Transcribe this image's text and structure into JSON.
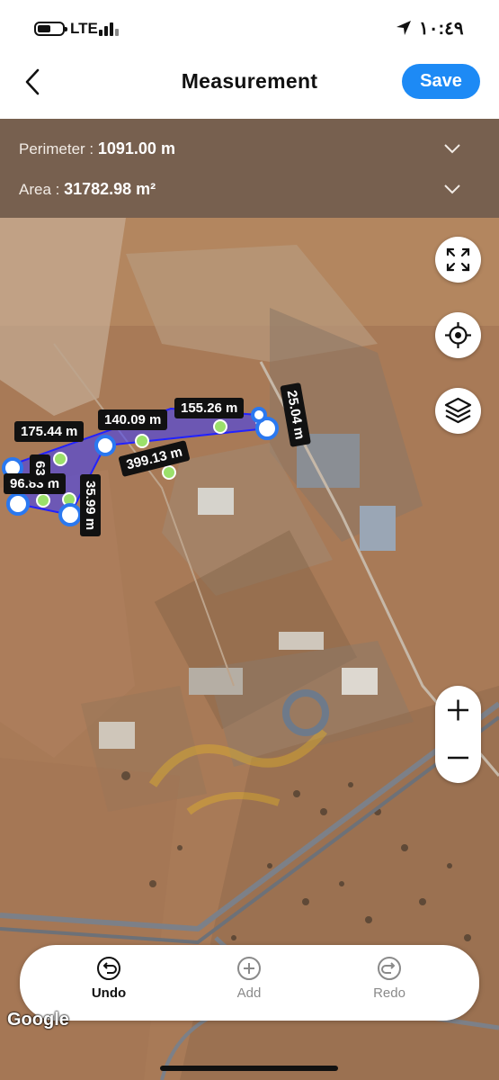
{
  "status_bar": {
    "network": "LTE",
    "time": "١٠:٤٩"
  },
  "header": {
    "title": "Measurement",
    "save_label": "Save",
    "back_icon": "chevron-left-icon"
  },
  "info": {
    "perimeter_label": "Perimeter :",
    "perimeter_value": "1091.00 m",
    "area_label": "Area :",
    "area_value": "31782.98 m²"
  },
  "map": {
    "segment_labels": {
      "s1": "175.44 m",
      "s2": "140.09 m",
      "s3": "155.26 m",
      "s4": "25.04 m",
      "s5": "399.13 m",
      "s6": "96.83 m",
      "s7": "63",
      "s8": "35.99 m"
    },
    "controls": [
      "fullscreen-icon",
      "locate-icon",
      "layers-icon",
      "zoom-in-icon",
      "zoom-out-icon"
    ],
    "polygon_color": "#3a3aff",
    "attribution": "Google"
  },
  "toolbar": {
    "undo_label": "Undo",
    "add_label": "Add",
    "redo_label": "Redo"
  }
}
